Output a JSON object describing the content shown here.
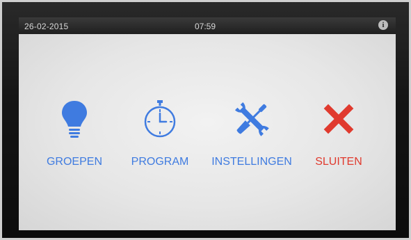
{
  "status_bar": {
    "date": "26-02-2015",
    "time": "07:59",
    "info_icon": "info-icon"
  },
  "menu": {
    "items": [
      {
        "label": "GROEPEN",
        "icon": "lightbulb-icon",
        "color": "#3f7be0"
      },
      {
        "label": "PROGRAM",
        "icon": "stopwatch-icon",
        "color": "#3f7be0"
      },
      {
        "label": "INSTELLINGEN",
        "icon": "tools-icon",
        "color": "#3f7be0"
      },
      {
        "label": "SLUITEN",
        "icon": "close-icon",
        "color": "#e03a2e"
      }
    ]
  },
  "colors": {
    "accent": "#3f7be0",
    "danger": "#e03a2e",
    "status_bar": "#262626",
    "screen_background": "#e6e6e6"
  }
}
